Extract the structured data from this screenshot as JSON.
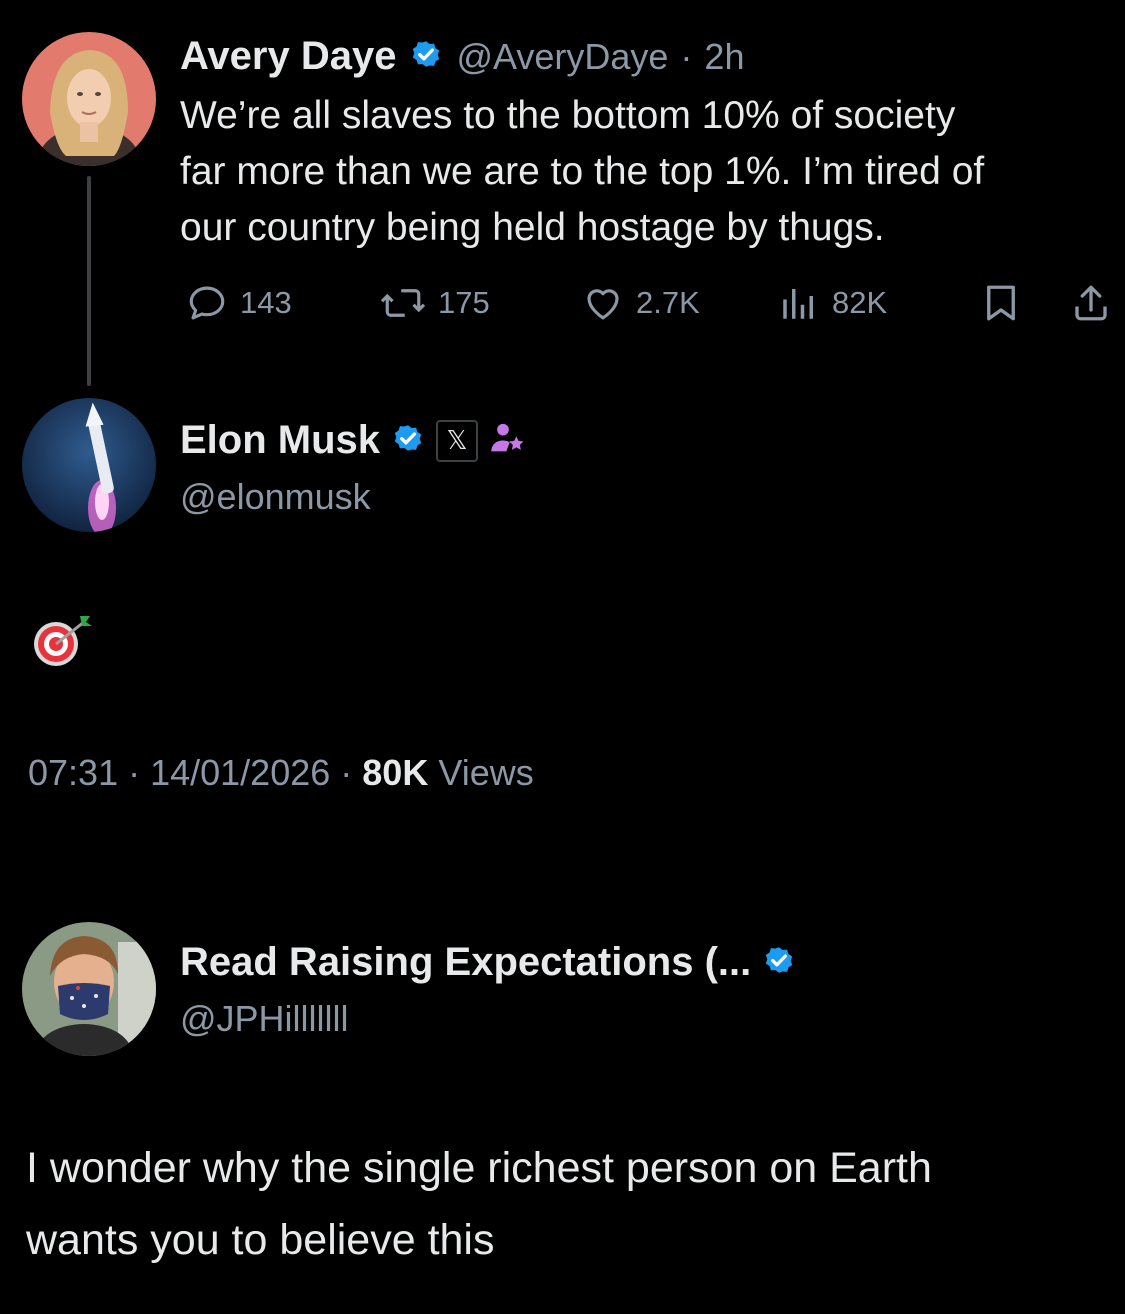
{
  "tweet1": {
    "author_name": "Avery Daye",
    "handle": "@AveryDaye",
    "separator": "·",
    "time": "2h",
    "text_lines": [
      "We’re all slaves to the bottom 10% of society",
      "far more than we are to the top 1%. I’m tired of",
      "our country being held hostage by thugs."
    ],
    "replies": "143",
    "reposts": "175",
    "likes": "2.7K",
    "views": "82K"
  },
  "tweet2": {
    "author_name": "Elon Musk",
    "handle": "@elonmusk",
    "affiliation_badge": "𝕏",
    "body_icon": "direct-hit-target-icon",
    "time": "07:31",
    "sep1": "·",
    "date": "14/01/2026",
    "sep2": "·",
    "views_count": "80K",
    "views_label": "Views"
  },
  "tweet3": {
    "author_name": "Read Raising Expectations (...",
    "handle": "@JPHilllllll",
    "text_lines": [
      "I wonder why the single richest person on Earth",
      "wants you to believe this"
    ]
  },
  "colors": {
    "background": "#000000",
    "text": "#e7e9ea",
    "muted": "#8b98a5",
    "verified": "#1d9bf0",
    "thread_line": "#3e4144"
  }
}
